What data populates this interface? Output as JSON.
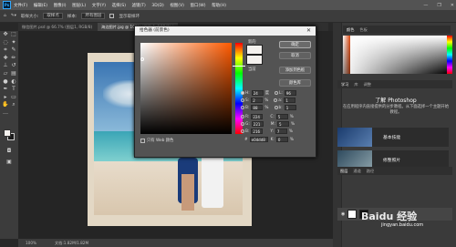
{
  "menubar": {
    "items": [
      "文件(F)",
      "编辑(E)",
      "图像(I)",
      "图层(L)",
      "文字(Y)",
      "选择(S)",
      "滤镜(T)",
      "3D(D)",
      "视图(V)",
      "窗口(W)",
      "帮助(H)"
    ],
    "window_controls": [
      "—",
      "❐",
      "✕"
    ]
  },
  "optbar": {
    "sample_size_label": "取样大小:",
    "sample_size_value": "取样点",
    "sample_label": "样本:",
    "sample_value": "所有图层",
    "show_ring_label": "显示取样环"
  },
  "doc_tabs": [
    {
      "label": "微信图片.psd @ 66.7% (图层1, RGB/8)",
      "active": false
    },
    {
      "label": "海边图片.jpg @ 100% (图层 0, RGB/8) *",
      "active": true
    }
  ],
  "statusbar": {
    "zoom": "100%",
    "info": "文档:1.82M/1.82M"
  },
  "color_picker": {
    "title": "拾色器 (前景色)",
    "close": "✕",
    "new_label": "新的",
    "current_label": "当前",
    "buttons": {
      "ok": "确定",
      "cancel": "取消",
      "add_swatch": "添加到色板",
      "libraries": "颜色库"
    },
    "fields": [
      {
        "label": "H:",
        "value": "24",
        "unit": "度",
        "label2": "L:",
        "value2": "96",
        "unit2": ""
      },
      {
        "label": "S:",
        "value": "2",
        "unit": "%",
        "label2": "a:",
        "value2": "1",
        "unit2": ""
      },
      {
        "label": "B:",
        "value": "88",
        "unit": "%",
        "label2": "b:",
        "value2": "1",
        "unit2": ""
      },
      {
        "label": "R:",
        "value": "224",
        "unit": "",
        "label2": "C:",
        "value2": "5",
        "unit2": "%"
      },
      {
        "label": "G:",
        "value": "221",
        "unit": "",
        "label2": "M:",
        "value2": "5",
        "unit2": "%"
      },
      {
        "label": "B:",
        "value": "216",
        "unit": "",
        "label2": "Y:",
        "value2": "7",
        "unit2": "%"
      },
      {
        "label": "#",
        "value": "e0ddd8",
        "unit": "",
        "label2": "K:",
        "value2": "0",
        "unit2": "%"
      }
    ],
    "web_only_label": "只有 Web 颜色",
    "new_color": "#f4f1ee"
  },
  "right_panel": {
    "color_tabs": [
      "颜色",
      "色板"
    ],
    "learn_tabs": [
      "学习",
      "库",
      "调整"
    ],
    "learn_title": "了解 Photoshop",
    "learn_text": "在应用程序内直接提供的分步教程。从下面选择一个主题开始教程。",
    "cards": [
      "基本技能",
      "修整照片"
    ],
    "layer_tabs": [
      "图层",
      "通道",
      "路径"
    ]
  },
  "watermark": {
    "main": "Baidu 经验",
    "sub": "jingyan.baidu.com"
  }
}
